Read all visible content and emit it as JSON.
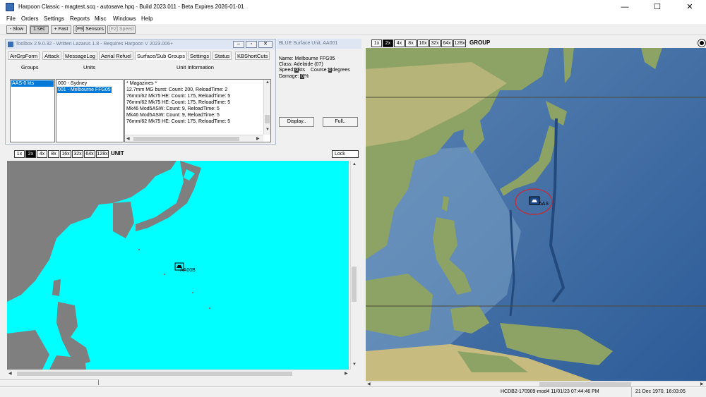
{
  "window": {
    "title": "Harpoon Classic - magtest.scq - autosave.hpq - Build 2023.011 - Beta Expires 2026-01-01",
    "minimize": "—",
    "maximize": "☐",
    "close": "✕"
  },
  "menu": [
    "File",
    "Orders",
    "Settings",
    "Reports",
    "Misc",
    "Windows",
    "Help"
  ],
  "toolbar": {
    "slow": "- Slow",
    "one_sec": "1 sec",
    "fast": "+ Fast",
    "sensors": "[F9] Sensors",
    "speed": "[F2] Speed"
  },
  "zoom_levels": [
    "1x",
    "2x",
    "4x",
    "8x",
    "16x",
    "32x",
    "64x",
    "128x"
  ],
  "zoom_selected": "2x",
  "right_map": {
    "label": "GROUP",
    "unit_label": "AAS"
  },
  "left_map": {
    "label": "UNIT",
    "lock": "Lock",
    "unit_label": "AA00B"
  },
  "toolbox": {
    "title": "Toolbox 2.9.0.32 - Written Lazarus 1.8 - Requires Harpoon V 2023.006+",
    "tabs": [
      "AirGrpForm",
      "Attack",
      "MessageLog",
      "Aerial Refuel",
      "Surface/Sub Groups",
      "Settings",
      "Status",
      "KBShortCuts"
    ],
    "selected_tab": "Surface/Sub Groups",
    "col_groups": "Groups",
    "col_units": "Units",
    "col_info": "Unit Information",
    "groups": [
      "AAS-0 kts"
    ],
    "units": [
      "000 - Sydney",
      "001 - Melbourne FFG05"
    ],
    "info_lines": [
      "* Magazines *",
      "12.7mm MG burst: Count: 200, ReloadTime: 2",
      "76mm/62 Mk75 HE: Count: 175, ReloadTime: 5",
      "76mm/62 Mk75 HE: Count: 175, ReloadTime: 5",
      "Mk46 Mod5ASW: Count: 9, ReloadTime: 5",
      "Mk46 Mod5ASW: Count: 9, ReloadTime: 5",
      "76mm/62 Mk75 HE: Count: 175, ReloadTime: 5"
    ]
  },
  "unit_panel": {
    "title": "BLUE Surface Unit, AA001",
    "name": "Name: Melbourne FFG05",
    "class": "Class: Adelaide (07)",
    "speed_label": "Speed:",
    "speed_value": "0",
    "speed_unit": "kts",
    "course_label": "Course:",
    "course_value": "0",
    "course_unit": "degrees",
    "damage_label": "Damage:",
    "damage_value": "0",
    "damage_unit": "%",
    "display_button": "Display..",
    "full_button": "Full.."
  },
  "status": {
    "db": "HCDB2-170909-mod4 11/01/23 07:44:46 PM",
    "datetime": "21 Dec 1970, 16:03:05"
  },
  "colors": {
    "ocean_left": "#00ffff",
    "land_left": "#7f7f7f",
    "selection": "#0078d7",
    "ring": "#d0252a"
  }
}
